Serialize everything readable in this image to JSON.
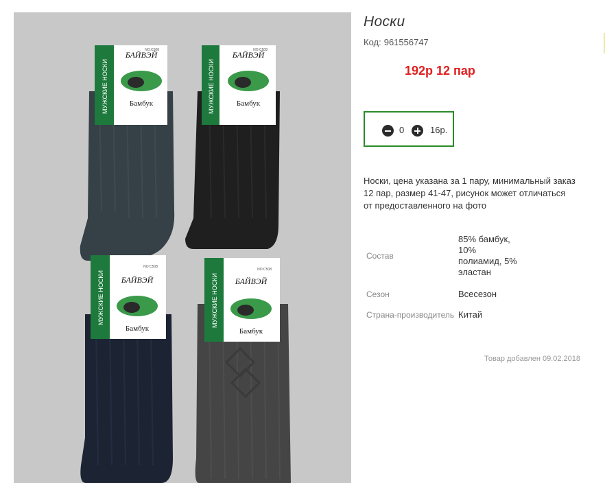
{
  "product": {
    "title": "Носки",
    "code_label": "Код:",
    "code_value": "961556747",
    "price_text": "192р 12 пар",
    "quantity": "0",
    "unit_price": "16р.",
    "description": "Носки, цена указана за 1 пару, минимальный заказ 12 пар, размер 41-47, рисунок может отличаться от предоставленного на фото",
    "added": "Товар добавлен 09.02.2018"
  },
  "properties": [
    {
      "key": "Состав",
      "value": "85% бамбук, 10% полиамид, 5% эластан"
    },
    {
      "key": "Сезон",
      "value": "Всесезон"
    },
    {
      "key": "Страна-производитель",
      "value": "Китай"
    }
  ],
  "package_labels": {
    "brand": "БАЙВЭЙ",
    "side_text": "МУЖСКИЕ НОСКИ",
    "material": "Бамбук",
    "model": "NO:C508"
  },
  "colors": {
    "price": "#e02020",
    "qty_border": "#2a8a2a",
    "photo_bg": "#c8c8c8",
    "label_green": "#1e7a3c"
  },
  "icons": [
    "minus-circle-icon",
    "plus-circle-icon"
  ]
}
